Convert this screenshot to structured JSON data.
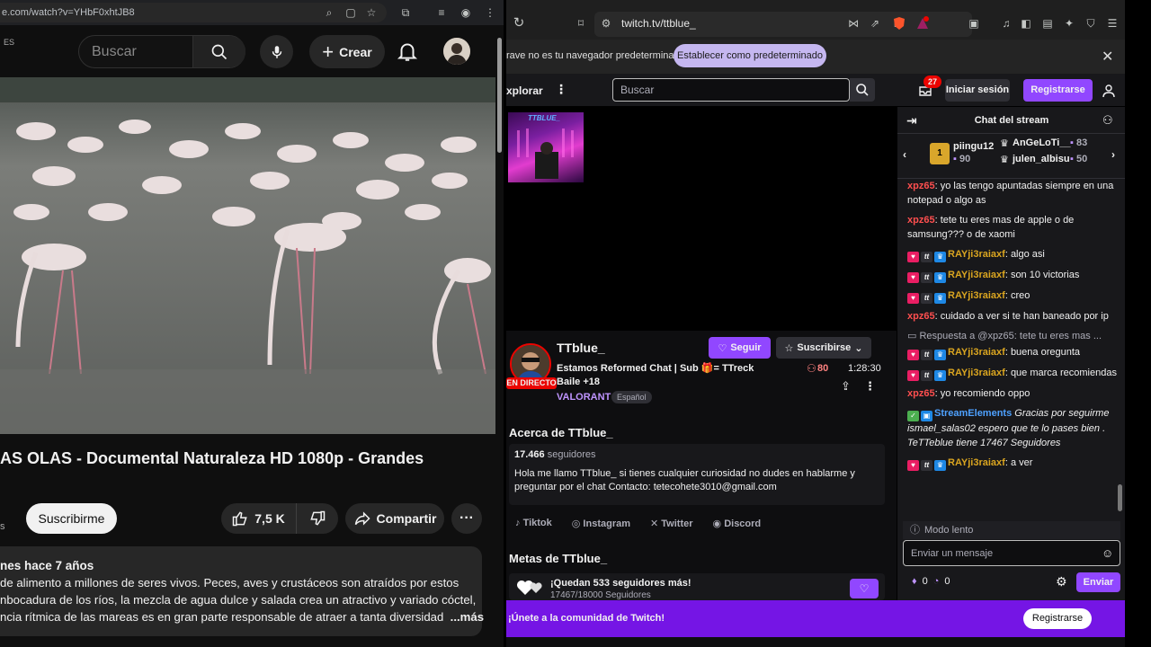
{
  "youtube": {
    "url": "e.com/watch?v=YHbF0xhtJB8",
    "country": "ES",
    "search_placeholder": "Buscar",
    "create_label": "Crear",
    "title": "AS OLAS - Documental Naturaleza HD 1080p - Grandes",
    "channel_fragment": "s",
    "subscribe_label": "Suscribirme",
    "likes": "7,5 K",
    "share_label": "Compartir",
    "desc_meta": "nes  hace 7 años",
    "desc_lines": [
      " de alimento a millones de seres vivos. Peces, aves y crustáceos son atraídos por estos",
      "nbocadura de los ríos, la mezcla de agua dulce y salada crea un atractivo y variado cóctel,",
      "ncia rítmica de las mareas es en gran parte responsable de atraer a tanta diversidad"
    ],
    "more_label": "...más"
  },
  "twitch": {
    "url": "twitch.tv/ttblue_",
    "info_text": "rave no es tu navegador predeterminado",
    "info_button": "Establecer como predeterminado",
    "explore": "xplorar",
    "search_placeholder": "Buscar",
    "notif_count": "27",
    "login": "Iniciar sesión",
    "register": "Registrarse",
    "thumb_label": "TTBLUE_",
    "channel": "TTblue_",
    "follow": "Seguir",
    "subscribe": "Suscribirse",
    "live_label": "EN DIRECTO",
    "stream_title": "Estamos Reformed Chat | Sub 🎁= TTreck Baile +18",
    "game": "VALORANT",
    "tag": "Español",
    "viewers": "80",
    "uptime": "1:28:30",
    "about_heading": "Acerca de TTblue_",
    "followers_count": "17.466",
    "followers_label": "seguidores",
    "bio": "Hola me llamo TTblue_ si tienes cualquier curiosidad no dudes en hablarme y preguntar por el chat Contacto: tetecohete3010@gmail.com",
    "socials": [
      "Tiktok",
      "Instagram",
      "Twitter",
      "Discord"
    ],
    "goals_heading": "Metas de TTblue_",
    "goal_title": "¡Quedan 533 seguidores más!",
    "goal_sub": "17467/18000 Seguidores",
    "goal_progress": 0.9704,
    "chat_title": "Chat del stream",
    "gifters": [
      {
        "name": "piingu12",
        "count": "90"
      },
      {
        "name": "AnGeLoTi__",
        "count": "83"
      },
      {
        "name": "julen_albisu",
        "count": "50"
      }
    ],
    "messages": [
      {
        "user": "xpz65",
        "color": "#ff4f4f",
        "text": "yo las tengo apuntadas siempre en una notepad o algo as"
      },
      {
        "user": "xpz65",
        "color": "#ff4f4f",
        "text": "tete tu eres mas de apple o de samsung??? o de xaomi"
      },
      {
        "user": "RAYji3raiaxf",
        "color": "#daa520",
        "text": "algo asi",
        "badges": true
      },
      {
        "user": "RAYji3raiaxf",
        "color": "#daa520",
        "text": "son 10 victorias",
        "badges": true
      },
      {
        "user": "RAYji3raiaxf",
        "color": "#daa520",
        "text": "creo",
        "badges": true
      },
      {
        "user": "xpz65",
        "color": "#ff4f4f",
        "text": "cuidado a ver si te han baneado por ip"
      }
    ],
    "reply_to": "Respuesta a @xpz65: tete tu eres mas ...",
    "messages2": [
      {
        "user": "RAYji3raiaxf",
        "color": "#daa520",
        "text": "buena oregunta",
        "badges": true
      },
      {
        "user": "RAYji3raiaxf",
        "color": "#daa520",
        "text": "que marca recomiendas",
        "badges": true
      },
      {
        "user": "xpz65",
        "color": "#ff4f4f",
        "text": "yo recomiendo oppo"
      }
    ],
    "bot_user": "StreamElements",
    "bot_text": "Gracias por seguirme ismael_salas02 espero que te lo pases bien . TeTTeblue tiene 17467 Seguidores",
    "last_user": "RAYji3raiaxf",
    "last_text": "a ver",
    "slow_mode": "Modo lento",
    "chat_placeholder": "Enviar un mensaje",
    "bits": "0",
    "points": "0",
    "send": "Enviar",
    "join_text": "¡Únete a la comunidad de Twitch!",
    "join_button": "Registrarse"
  }
}
